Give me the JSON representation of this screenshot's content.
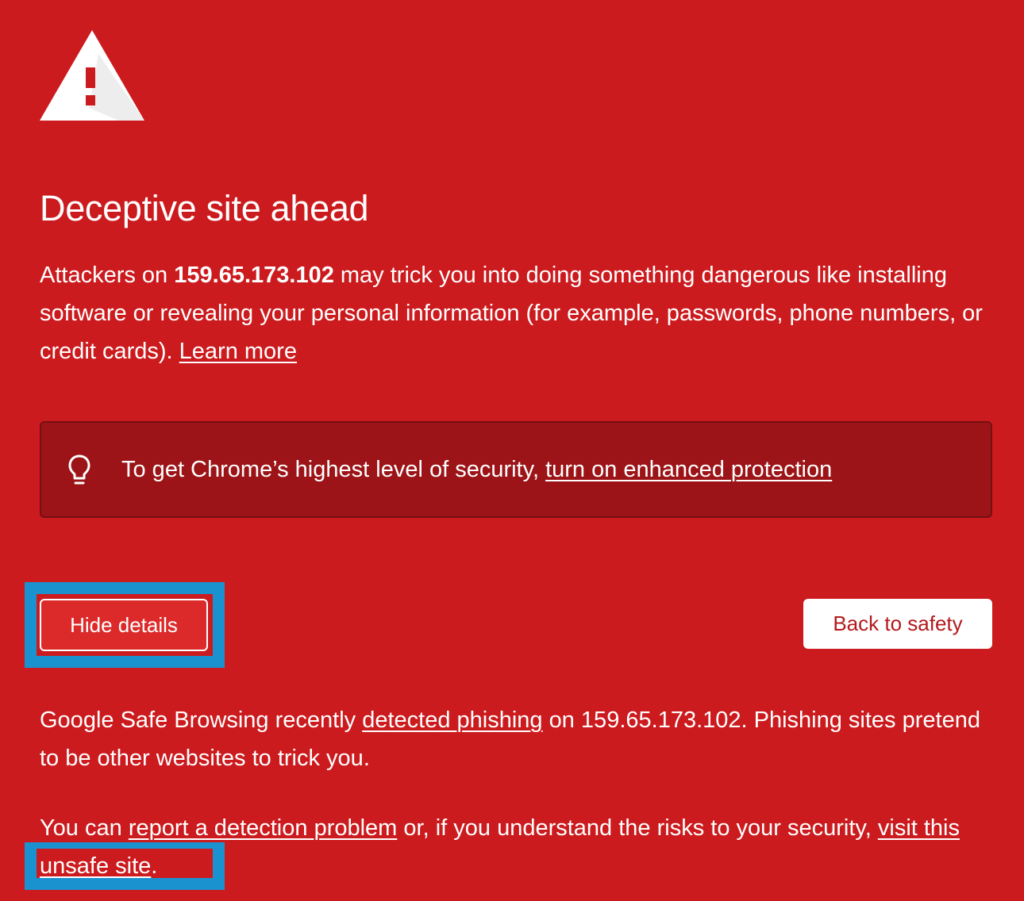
{
  "colors": {
    "background": "#cc1b1e",
    "promo_background": "#9c1417",
    "highlight": "#1a92d0",
    "hide_button_background": "#dc2a2a",
    "back_button_text": "#b3191c"
  },
  "icons": {
    "warning": "warning-triangle-icon",
    "promo": "lightbulb-icon"
  },
  "heading": "Deceptive site ahead",
  "intro": {
    "prefix": "Attackers on ",
    "host": "159.65.173.102",
    "text": " may trick you into doing something dangerous like installing software or revealing your personal information (for example, passwords, phone numbers, or credit cards). ",
    "learn_more": "Learn more"
  },
  "promo": {
    "text": "To get Chrome’s highest level of security, ",
    "link": "turn on enhanced protection"
  },
  "buttons": {
    "hide_details": "Hide details",
    "back_to_safety": "Back to safety"
  },
  "details": {
    "p1_prefix": "Google Safe Browsing recently ",
    "p1_link": "detected phishing",
    "p1_suffix": " on 159.65.173.102. Phishing sites pretend to be other websites to trick you.",
    "p2_prefix": "You can ",
    "p2_link1": "report a detection problem",
    "p2_middle": " or, if you understand the risks to your security, ",
    "p2_link2": "visit this unsafe site",
    "p2_end": "."
  }
}
